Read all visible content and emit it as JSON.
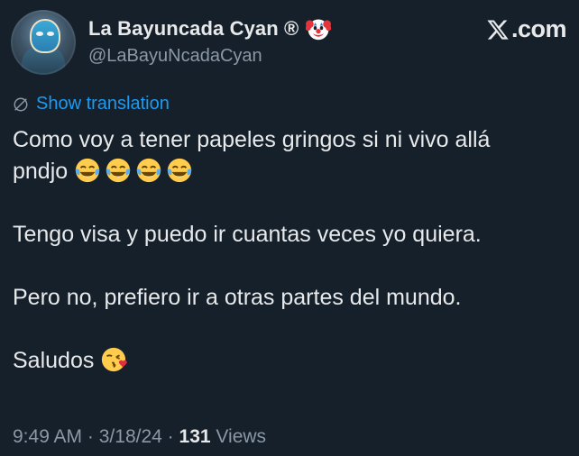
{
  "author": {
    "display_name": "La Bayuncada Cyan ®",
    "handle": "@LaBayuNcadaCyan",
    "badge_icon": "clown-face-icon"
  },
  "brand": {
    "label": ".com",
    "logo_icon": "x-logo-icon"
  },
  "translation": {
    "label": "Show translation",
    "icon": "globe-icon",
    "color": "#1d9bf0"
  },
  "tweet": {
    "line1": "Como voy a tener papeles gringos si ni vivo allá",
    "line2": "pndjo",
    "line2_emojis": [
      "face-with-tears-of-joy-icon",
      "face-with-tears-of-joy-icon",
      "face-with-tears-of-joy-icon",
      "face-with-tears-of-joy-icon"
    ],
    "line3": "Tengo visa y puedo ir cuantas veces yo quiera.",
    "line4": "Pero no, prefiero ir a otras partes del mundo.",
    "line5": "Saludos",
    "line5_emoji": "face-blowing-a-kiss-icon"
  },
  "meta": {
    "time": "9:49 AM",
    "sep1": "·",
    "date": "3/18/24",
    "sep2": "·",
    "views_count": "131",
    "views_label": "Views"
  },
  "colors": {
    "background": "#15202b",
    "text": "#e7e9ea",
    "muted": "#8b98a5",
    "link": "#1d9bf0"
  }
}
